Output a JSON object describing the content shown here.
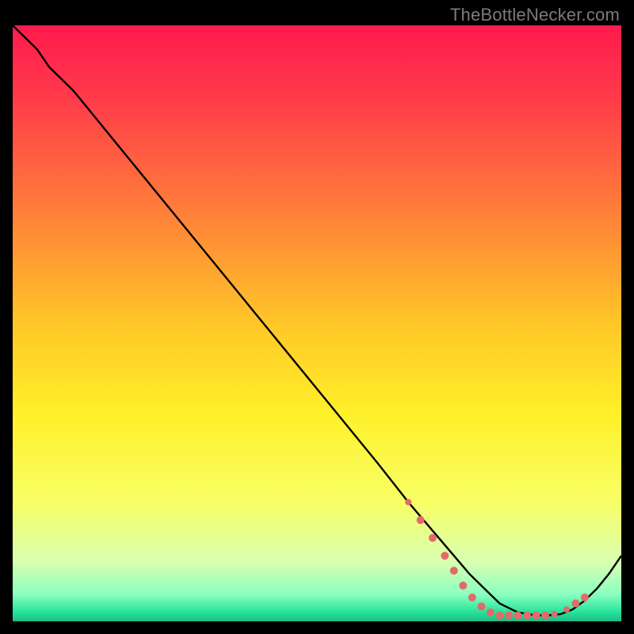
{
  "watermark": "TheBottleNecker.com",
  "chart_data": {
    "type": "line",
    "title": "",
    "xlabel": "",
    "ylabel": "",
    "xlim": [
      0,
      100
    ],
    "ylim": [
      0,
      100
    ],
    "grid": false,
    "background": "rainbow-gradient",
    "series": [
      {
        "name": "curve",
        "color": "#000000",
        "x": [
          0,
          4,
          6,
          10,
          20,
          30,
          40,
          50,
          60,
          65,
          70,
          75,
          78,
          80,
          83,
          86,
          88,
          90,
          92,
          94,
          96,
          98,
          100
        ],
        "y": [
          100,
          96,
          93,
          89,
          76.5,
          64,
          51.5,
          39,
          26.5,
          20,
          14,
          8,
          5,
          3,
          1.5,
          1,
          1,
          1.2,
          2,
          3.5,
          5.5,
          8,
          11
        ]
      }
    ],
    "markers": {
      "color": "#e36a6a",
      "radius_small": 4,
      "radius_large": 6,
      "points": [
        {
          "x": 65,
          "y": 20,
          "r": 4
        },
        {
          "x": 67,
          "y": 17,
          "r": 5
        },
        {
          "x": 69,
          "y": 14,
          "r": 5
        },
        {
          "x": 71,
          "y": 11,
          "r": 5
        },
        {
          "x": 72.5,
          "y": 8.5,
          "r": 5
        },
        {
          "x": 74,
          "y": 6,
          "r": 5
        },
        {
          "x": 75.5,
          "y": 4,
          "r": 5
        },
        {
          "x": 77,
          "y": 2.5,
          "r": 5
        },
        {
          "x": 78.5,
          "y": 1.5,
          "r": 5
        },
        {
          "x": 80,
          "y": 1,
          "r": 5
        },
        {
          "x": 81.5,
          "y": 1,
          "r": 5
        },
        {
          "x": 83,
          "y": 1,
          "r": 5
        },
        {
          "x": 84.5,
          "y": 1,
          "r": 5
        },
        {
          "x": 86,
          "y": 1,
          "r": 5
        },
        {
          "x": 87.5,
          "y": 1,
          "r": 5
        },
        {
          "x": 89,
          "y": 1.2,
          "r": 4
        },
        {
          "x": 91,
          "y": 2,
          "r": 4
        },
        {
          "x": 92.5,
          "y": 3,
          "r": 5
        },
        {
          "x": 94,
          "y": 4,
          "r": 5
        }
      ]
    },
    "gradient_stops": [
      {
        "offset": 0.0,
        "color": "#ff1a4d"
      },
      {
        "offset": 0.12,
        "color": "#ff3a4a"
      },
      {
        "offset": 0.3,
        "color": "#ff7a3a"
      },
      {
        "offset": 0.5,
        "color": "#ffc628"
      },
      {
        "offset": 0.65,
        "color": "#fff029"
      },
      {
        "offset": 0.8,
        "color": "#f8ff66"
      },
      {
        "offset": 0.9,
        "color": "#d9ffb0"
      },
      {
        "offset": 0.955,
        "color": "#8affc0"
      },
      {
        "offset": 0.985,
        "color": "#24e39a"
      },
      {
        "offset": 1.0,
        "color": "#1fb985"
      }
    ]
  }
}
